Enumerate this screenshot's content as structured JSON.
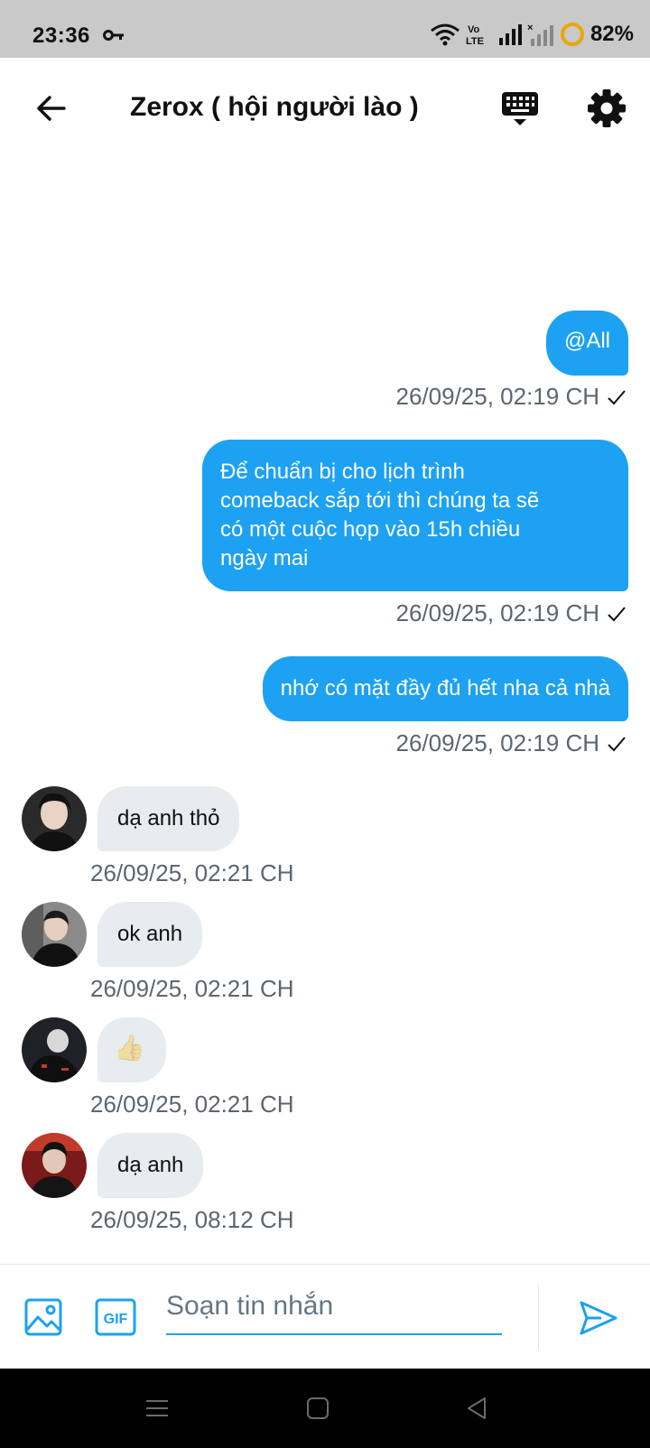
{
  "status_bar": {
    "time": "23:36",
    "battery": "82%",
    "icons": [
      "key-icon",
      "wifi-icon",
      "volte-icon",
      "signal-icon",
      "signal-no-sim-icon",
      "battery-icon"
    ]
  },
  "header": {
    "title": "Zerox ( hội người lào )",
    "icons": [
      "back-arrow-icon",
      "keyboard-icon",
      "gear-icon"
    ]
  },
  "messages": [
    {
      "direction": "out",
      "lines": [
        "@All"
      ],
      "timestamp": "26/09/25, 02:19 CH",
      "read": true
    },
    {
      "direction": "out",
      "lines": [
        "Để chuẩn bị cho lịch trình",
        "comeback sắp tới thì chúng ta sẽ",
        "có một cuộc họp vào 15h chiều",
        "ngày mai"
      ],
      "timestamp": "26/09/25, 02:19 CH",
      "read": true
    },
    {
      "direction": "out",
      "lines": [
        "nhớ có mặt đầy đủ hết nha cả nhà"
      ],
      "timestamp": "26/09/25, 02:19 CH",
      "read": true
    },
    {
      "direction": "in",
      "text": "dạ anh thỏ",
      "timestamp": "26/09/25, 02:21 CH"
    },
    {
      "direction": "in",
      "text": "ok anh",
      "timestamp": "26/09/25, 02:21 CH"
    },
    {
      "direction": "in",
      "text": "👍",
      "timestamp": "26/09/25, 02:21 CH"
    },
    {
      "direction": "in",
      "text": "dạ anh",
      "timestamp": "26/09/25, 08:12 CH"
    }
  ],
  "composer": {
    "placeholder": "Soạn tin nhắn",
    "gif_label": "GIF",
    "icons": [
      "image-icon",
      "gif-icon",
      "send-icon"
    ]
  },
  "colors": {
    "accent": "#1da1f2",
    "incoming_bubble": "#e6ecf0",
    "meta_text": "#5b6670"
  }
}
